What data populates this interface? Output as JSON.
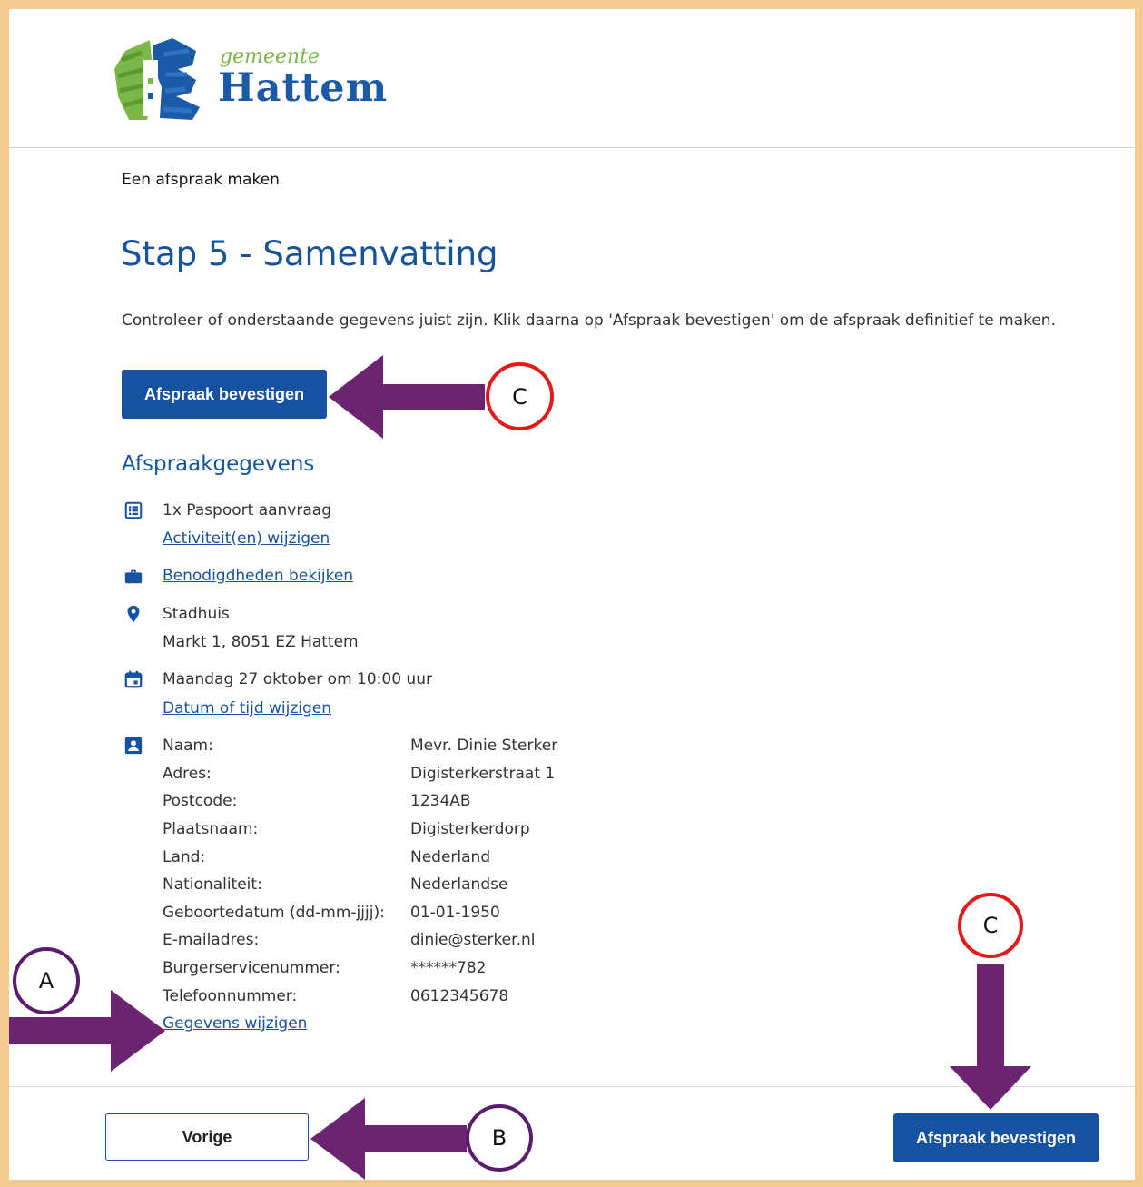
{
  "header": {
    "logo_gemeente": "gemeente",
    "logo_hattem": "Hattem"
  },
  "breadcrumb": "Een afspraak maken",
  "page_title": "Stap 5 - Samenvatting",
  "intro": "Controleer of onderstaande gegevens juist zijn. Klik daarna op 'Afspraak bevestigen' om de afspraak definitief te maken.",
  "confirm_label": "Afspraak bevestigen",
  "section_title": "Afspraakgegevens",
  "activity": {
    "text": "1x Paspoort aanvraag",
    "change_link": "Activiteit(en) wijzigen"
  },
  "requirements_link": "Benodigdheden bekijken",
  "location": {
    "name": "Stadhuis",
    "address": "Markt 1, 8051 EZ Hattem"
  },
  "datetime": {
    "text": "Maandag 27 oktober om 10:00 uur",
    "change_link": "Datum of tijd wijzigen"
  },
  "personal": {
    "rows": [
      {
        "label": "Naam:",
        "value": "Mevr. Dinie Sterker"
      },
      {
        "label": "Adres:",
        "value": "Digisterkerstraat 1"
      },
      {
        "label": "Postcode:",
        "value": "1234AB"
      },
      {
        "label": "Plaatsnaam:",
        "value": "Digisterkerdorp"
      },
      {
        "label": "Land:",
        "value": "Nederland"
      },
      {
        "label": "Nationaliteit:",
        "value": "Nederlandse"
      },
      {
        "label": "Geboortedatum (dd-mm-jjjj):",
        "value": "01-01-1950"
      },
      {
        "label": "E-mailadres:",
        "value": "dinie@sterker.nl"
      },
      {
        "label": "Burgerservicenummer:",
        "value": "******782"
      },
      {
        "label": "Telefoonnummer:",
        "value": "0612345678"
      }
    ],
    "change_link": "Gegevens wijzigen"
  },
  "footer": {
    "prev_label": "Vorige",
    "confirm_label": "Afspraak bevestigen"
  },
  "annotations": {
    "marker_a": "A",
    "marker_b": "B",
    "marker_c_top": "C",
    "marker_c_bottom": "C"
  },
  "colors": {
    "primary": "#1652a0",
    "logo_green": "#7ab648",
    "frame": "#f6cb91",
    "arrow": "#6b2470",
    "marker_red": "#e3191c"
  }
}
